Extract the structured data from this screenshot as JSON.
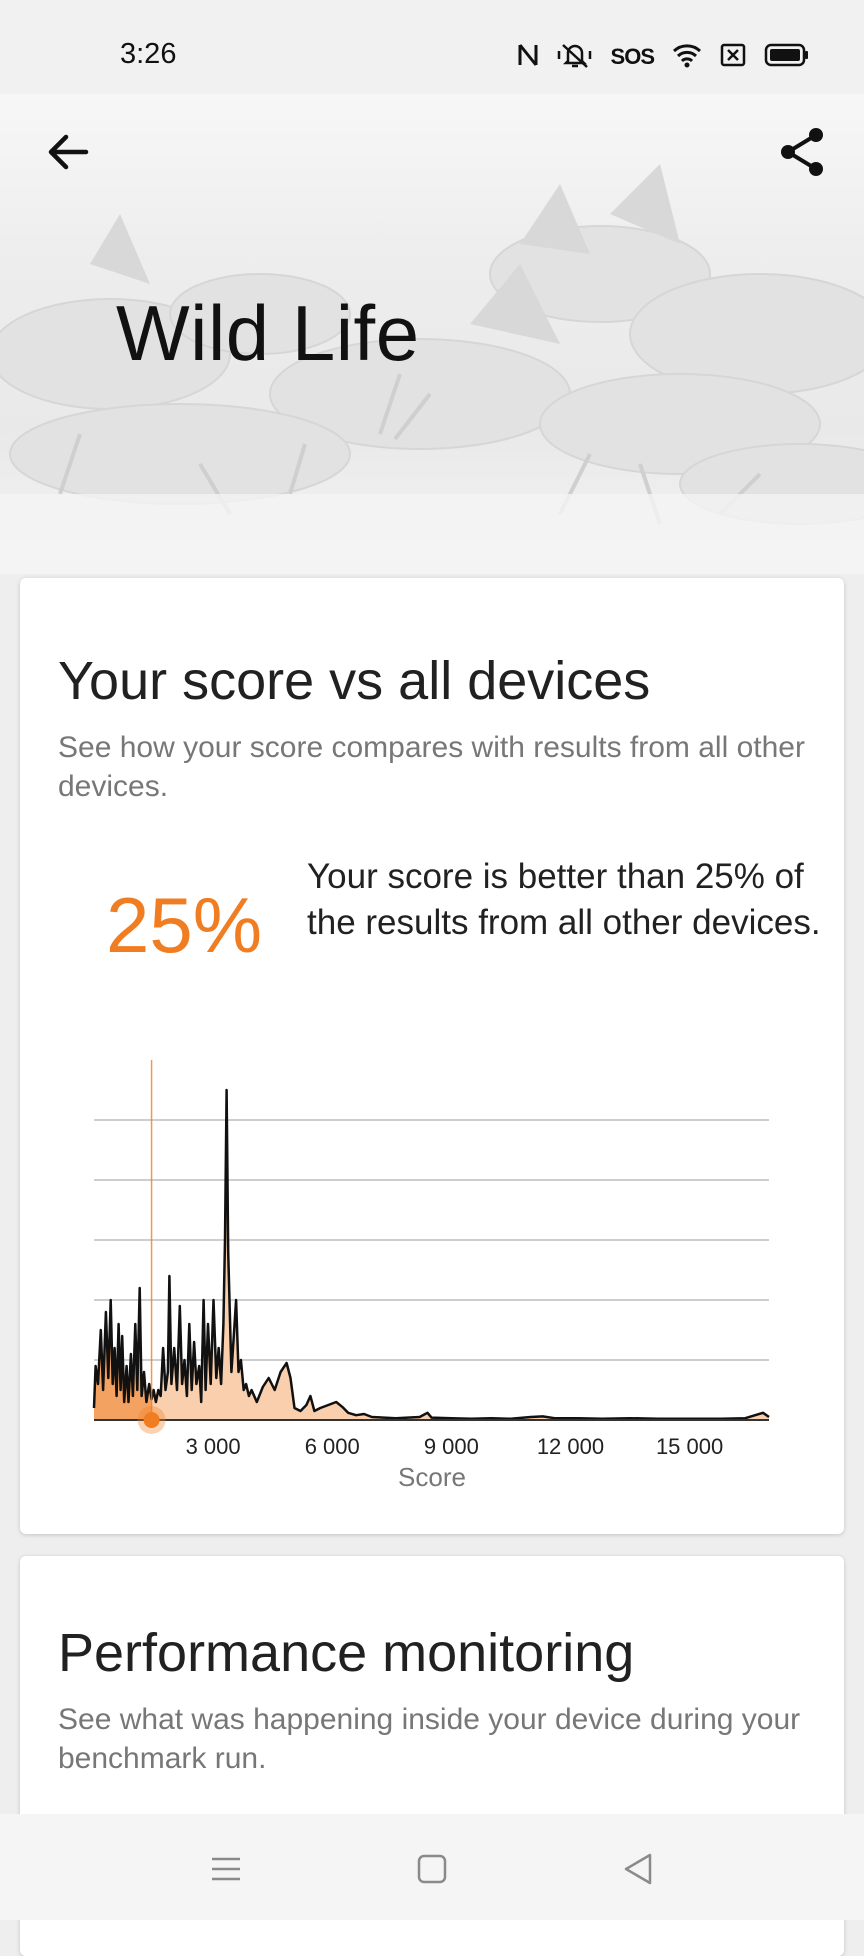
{
  "status_bar": {
    "time": "3:26",
    "sos": "SOS",
    "icons": [
      "nfc-icon",
      "vibrate-off-icon",
      "wifi-icon",
      "sim-icon",
      "battery-icon"
    ]
  },
  "hero": {
    "title": "Wild Life",
    "back_icon": "arrow-left-icon",
    "share_icon": "share-icon"
  },
  "score_card": {
    "title": "Your score vs all devices",
    "subtitle": "See how your score compares with results from all other devices.",
    "percent": "25%",
    "percent_text": "Your score is better than 25% of the results from all other devices."
  },
  "chart_data": {
    "type": "area",
    "xlabel": "Score",
    "ylabel": "",
    "xlim": [
      0,
      17000
    ],
    "ylim": [
      0,
      5
    ],
    "grid": true,
    "x_ticks": [
      3000,
      6000,
      9000,
      12000,
      15000
    ],
    "x_tick_labels": [
      "3 000",
      "6 000",
      "9 000",
      "12 000",
      "15 000"
    ],
    "marker_score": 1450,
    "accent_color": "#f07d22",
    "fill_color": "#f9cfae",
    "points": [
      [
        0,
        0.2
      ],
      [
        40,
        0.9
      ],
      [
        100,
        0.6
      ],
      [
        170,
        1.5
      ],
      [
        230,
        0.5
      ],
      [
        300,
        1.8
      ],
      [
        360,
        0.7
      ],
      [
        420,
        2.0
      ],
      [
        470,
        0.6
      ],
      [
        520,
        1.2
      ],
      [
        570,
        0.4
      ],
      [
        620,
        1.6
      ],
      [
        670,
        0.5
      ],
      [
        710,
        1.4
      ],
      [
        760,
        0.3
      ],
      [
        820,
        0.9
      ],
      [
        870,
        0.3
      ],
      [
        930,
        1.1
      ],
      [
        980,
        0.4
      ],
      [
        1040,
        1.6
      ],
      [
        1090,
        0.5
      ],
      [
        1150,
        2.2
      ],
      [
        1200,
        0.4
      ],
      [
        1260,
        0.8
      ],
      [
        1320,
        0.3
      ],
      [
        1390,
        0.6
      ],
      [
        1450,
        0.35
      ],
      [
        1500,
        0.5
      ],
      [
        1560,
        0.3
      ],
      [
        1620,
        0.5
      ],
      [
        1680,
        0.4
      ],
      [
        1740,
        1.2
      ],
      [
        1800,
        0.5
      ],
      [
        1860,
        0.8
      ],
      [
        1900,
        2.4
      ],
      [
        1950,
        0.6
      ],
      [
        2020,
        1.2
      ],
      [
        2090,
        0.5
      ],
      [
        2160,
        1.9
      ],
      [
        2220,
        0.6
      ],
      [
        2280,
        1.0
      ],
      [
        2340,
        0.4
      ],
      [
        2400,
        1.6
      ],
      [
        2460,
        0.5
      ],
      [
        2520,
        1.3
      ],
      [
        2580,
        0.6
      ],
      [
        2650,
        0.9
      ],
      [
        2700,
        0.3
      ],
      [
        2760,
        2.0
      ],
      [
        2810,
        0.5
      ],
      [
        2870,
        1.6
      ],
      [
        2940,
        0.6
      ],
      [
        3010,
        2.0
      ],
      [
        3080,
        0.7
      ],
      [
        3140,
        1.2
      ],
      [
        3200,
        0.6
      ],
      [
        3260,
        1.6
      ],
      [
        3300,
        3.0
      ],
      [
        3340,
        5.5
      ],
      [
        3380,
        2.8
      ],
      [
        3420,
        1.8
      ],
      [
        3460,
        0.8
      ],
      [
        3520,
        1.4
      ],
      [
        3580,
        2.0
      ],
      [
        3640,
        0.8
      ],
      [
        3700,
        1.0
      ],
      [
        3770,
        0.5
      ],
      [
        3830,
        0.6
      ],
      [
        3900,
        0.4
      ],
      [
        3970,
        0.5
      ],
      [
        4100,
        0.3
      ],
      [
        4250,
        0.55
      ],
      [
        4400,
        0.7
      ],
      [
        4550,
        0.5
      ],
      [
        4700,
        0.8
      ],
      [
        4850,
        0.95
      ],
      [
        4950,
        0.7
      ],
      [
        5050,
        0.2
      ],
      [
        5200,
        0.15
      ],
      [
        5350,
        0.25
      ],
      [
        5450,
        0.4
      ],
      [
        5550,
        0.15
      ],
      [
        5700,
        0.2
      ],
      [
        5900,
        0.25
      ],
      [
        6100,
        0.3
      ],
      [
        6250,
        0.22
      ],
      [
        6400,
        0.12
      ],
      [
        6600,
        0.08
      ],
      [
        6800,
        0.1
      ],
      [
        7000,
        0.05
      ],
      [
        7300,
        0.04
      ],
      [
        7600,
        0.03
      ],
      [
        7900,
        0.04
      ],
      [
        8200,
        0.05
      ],
      [
        8400,
        0.12
      ],
      [
        8500,
        0.04
      ],
      [
        9000,
        0.03
      ],
      [
        9500,
        0.02
      ],
      [
        10000,
        0.03
      ],
      [
        10500,
        0.02
      ],
      [
        11000,
        0.05
      ],
      [
        11300,
        0.06
      ],
      [
        11600,
        0.03
      ],
      [
        12200,
        0.03
      ],
      [
        12800,
        0.02
      ],
      [
        13500,
        0.03
      ],
      [
        14200,
        0.02
      ],
      [
        15000,
        0.02
      ],
      [
        15800,
        0.02
      ],
      [
        16400,
        0.03
      ],
      [
        16850,
        0.12
      ],
      [
        17000,
        0.05
      ]
    ]
  },
  "perf_card": {
    "title": "Performance monitoring",
    "subtitle": "See what was happening inside your device during your benchmark run."
  },
  "nav_bar": {
    "icons": [
      "menu-icon",
      "home-icon",
      "back-triangle-icon"
    ]
  }
}
